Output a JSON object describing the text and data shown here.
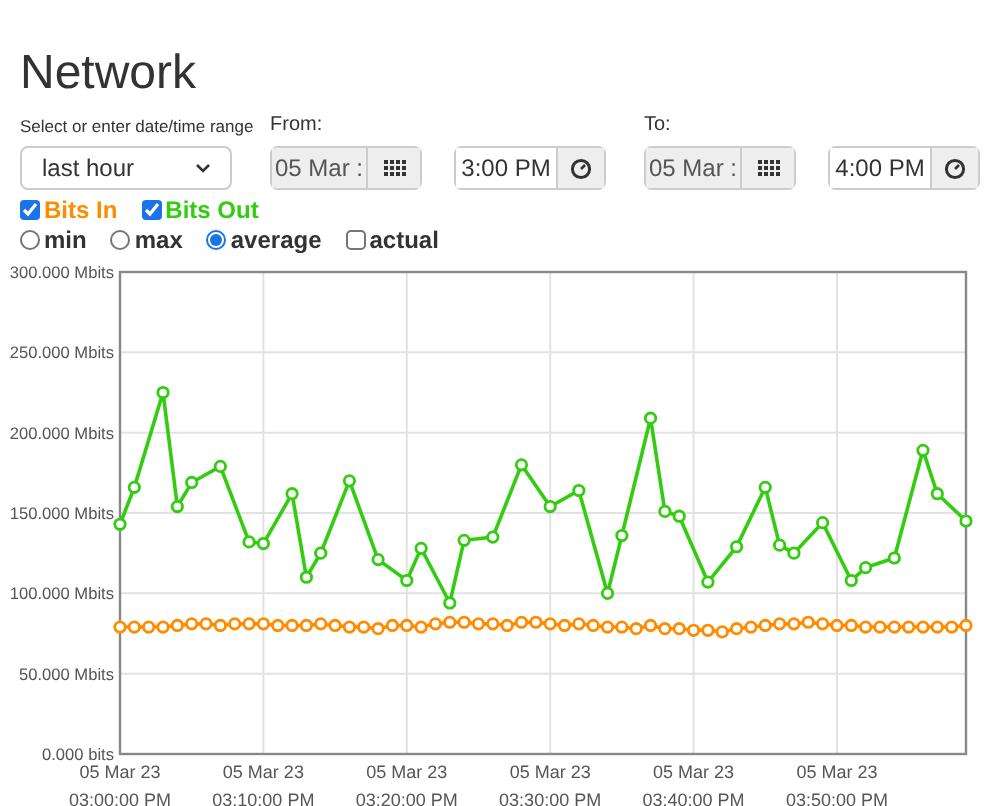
{
  "title": "Network",
  "range": {
    "label": "Select or enter date/time range",
    "value": "last hour"
  },
  "from": {
    "label": "From:",
    "date": "05 Mar :",
    "time": "3:00 PM"
  },
  "to": {
    "label": "To:",
    "date": "05 Mar :",
    "time": "4:00 PM"
  },
  "series_toggles": [
    {
      "checked": true
    },
    {
      "checked": true
    }
  ],
  "modes": [
    {
      "label": "min",
      "kind": "radio",
      "selected": false
    },
    {
      "label": "max",
      "kind": "radio",
      "selected": false
    },
    {
      "label": "average",
      "kind": "radio",
      "selected": true
    },
    {
      "label": "actual",
      "kind": "checkbox",
      "selected": false
    }
  ],
  "chart_data": {
    "type": "line",
    "categories": [
      "05 Mar 23\n03:00:00 PM",
      null,
      null,
      null,
      null,
      null,
      null,
      null,
      null,
      null,
      "05 Mar 23\n03:10:00 PM",
      null,
      null,
      null,
      null,
      null,
      null,
      null,
      null,
      null,
      "05 Mar 23\n03:20:00 PM",
      null,
      null,
      null,
      null,
      null,
      null,
      null,
      null,
      null,
      "05 Mar 23\n03:30:00 PM",
      null,
      null,
      null,
      null,
      null,
      null,
      null,
      null,
      null,
      "05 Mar 23\n03:40:00 PM",
      null,
      null,
      null,
      null,
      null,
      null,
      null,
      null,
      null,
      "05 Mar 23\n03:50:00 PM",
      null,
      null,
      null,
      null,
      null,
      null,
      null,
      null,
      null
    ],
    "series": [
      {
        "name": "Bits In",
        "color": "#ff8c00",
        "marker": "circle",
        "values": [
          79,
          79,
          79,
          79,
          80,
          81,
          81,
          80,
          81,
          81,
          81,
          80,
          80,
          80,
          81,
          80,
          79,
          79,
          78,
          80,
          80,
          79,
          81,
          82,
          82,
          81,
          81,
          80,
          82,
          82,
          81,
          80,
          81,
          80,
          79,
          79,
          78,
          80,
          78,
          78,
          77,
          77,
          76,
          78,
          79,
          80,
          81,
          81,
          82,
          81,
          80,
          80,
          79,
          79,
          79,
          79,
          79,
          79,
          79,
          80
        ]
      },
      {
        "name": "Bits Out",
        "color": "#33cc11",
        "marker": "circle",
        "values": [
          143,
          166,
          null,
          225,
          154,
          169,
          null,
          179,
          null,
          132,
          131,
          null,
          162,
          110,
          125,
          null,
          170,
          null,
          121,
          null,
          108,
          128,
          null,
          94,
          133,
          null,
          135,
          null,
          180,
          null,
          154,
          null,
          164,
          null,
          100,
          136,
          null,
          209,
          151,
          148,
          null,
          107,
          null,
          129,
          null,
          166,
          130,
          125,
          null,
          144,
          null,
          108,
          116,
          null,
          122,
          null,
          189,
          162,
          null,
          145
        ]
      }
    ],
    "ylim": [
      0,
      300
    ],
    "grid": true,
    "yticks": [
      {
        "value": 0,
        "label": "0.000 bits"
      },
      {
        "value": 50,
        "label": "50.000 Mbits"
      },
      {
        "value": 100,
        "label": "100.000 Mbits"
      },
      {
        "value": 150,
        "label": "150.000 Mbits"
      },
      {
        "value": 200,
        "label": "200.000 Mbits"
      },
      {
        "value": 250,
        "label": "250.000 Mbits"
      },
      {
        "value": 300,
        "label": "300.000 Mbits"
      }
    ]
  }
}
